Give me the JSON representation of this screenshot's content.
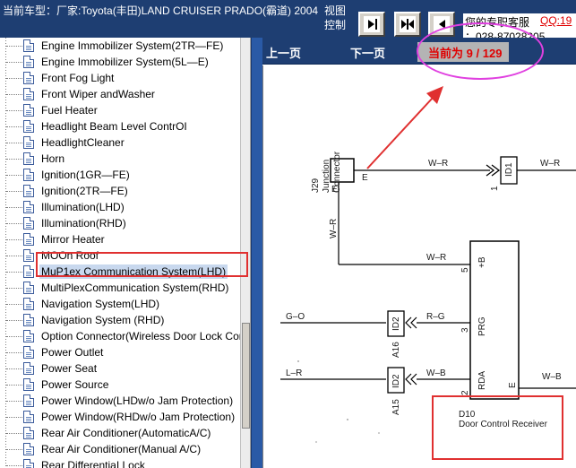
{
  "header": {
    "car_title": "当前车型：厂家:Toyota(丰田)LAND CRUISER PRADO(霸道) 2004",
    "view_label": "视图控制",
    "buttons": [
      {
        "name": "fit-width",
        "icon": "arrow-right-bar-icon"
      },
      {
        "name": "fit-page",
        "icon": "arrows-inward-icon"
      },
      {
        "name": "back",
        "icon": "arrow-left-icon"
      }
    ],
    "service_text": "您的专职客服",
    "service_qq": "QQ:19",
    "service_phone": "：028-87028205"
  },
  "tree": {
    "items": [
      {
        "label": "Engine Immobilizer System(2TR—FE)",
        "selected": false
      },
      {
        "label": "Engine Immobilizer System(5L—E)",
        "selected": false
      },
      {
        "label": "Front Fog Light",
        "selected": false
      },
      {
        "label": "Front Wiper andWasher",
        "selected": false
      },
      {
        "label": "Fuel Heater",
        "selected": false
      },
      {
        "label": "Headlight Beam Level ContrOI",
        "selected": false
      },
      {
        "label": "HeadlightCleaner",
        "selected": false
      },
      {
        "label": "Horn",
        "selected": false
      },
      {
        "label": "Ignition(1GR—FE)",
        "selected": false
      },
      {
        "label": "Ignition(2TR—FE)",
        "selected": false
      },
      {
        "label": "Illumination(LHD)",
        "selected": false
      },
      {
        "label": "Illumination(RHD)",
        "selected": false
      },
      {
        "label": "Mirror Heater",
        "selected": false
      },
      {
        "label": "MOOn Roof",
        "selected": false
      },
      {
        "label": "MuP1ex Communication System(LHD)",
        "selected": true
      },
      {
        "label": "MultiPlexCommunication System(RHD)",
        "selected": false
      },
      {
        "label": "Navigation System(LHD)",
        "selected": false
      },
      {
        "label": "Navigation System (RHD)",
        "selected": false
      },
      {
        "label": "Option Connector(Wireless Door Lock Control)",
        "selected": false
      },
      {
        "label": "Power Outlet",
        "selected": false
      },
      {
        "label": "Power Seat",
        "selected": false
      },
      {
        "label": "Power Source",
        "selected": false
      },
      {
        "label": "Power Window(LHDw/o Jam Protection)",
        "selected": false
      },
      {
        "label": "Power Window(RHDw/o Jam Protection)",
        "selected": false
      },
      {
        "label": "Rear Air Conditioner(AutomaticA/C)",
        "selected": false
      },
      {
        "label": "Rear Air Conditioner(Manual A/C)",
        "selected": false
      },
      {
        "label": "Rear DifferentiaI Lock",
        "selected": false
      }
    ]
  },
  "viewer": {
    "prev_label": "上一页",
    "next_label": "下一页",
    "page_prefix": "当前为",
    "page_current": 9,
    "page_separator": "/",
    "page_total": 129
  },
  "diagram": {
    "junction_label": "J29\nJunction\nConnector",
    "junction_pin": "E",
    "junction_pin2": "E",
    "wire_wr_top": "W–R",
    "wire_wr_top2": "W–R",
    "wire_wr_vertical": "W–R",
    "wire_wr_mid": "W–R",
    "wire_go": "G–O",
    "wire_rg": "R–G",
    "wire_lr": "L–R",
    "wire_wb": "W–B",
    "wire_wb2": "W–B",
    "id1_label": "ID1",
    "id1_pin": "1",
    "id2a_label": "ID2",
    "id2a_ref": "A16",
    "id2b_label": "ID2",
    "id2b_ref": "A15",
    "pin_5": "5",
    "pin_3": "3",
    "pin_2": "2",
    "plus_b": "+B",
    "prg": "PRG",
    "rda": "RDA",
    "e_pin": "E",
    "d10_code": "D10",
    "d10_name": "Door Control Receiver"
  },
  "colors": {
    "header_bg": "#1e3e72",
    "splitter": "#2a5aa6",
    "annotation_magenta": "#e040e0",
    "annotation_red": "#e03030",
    "page_indicator_text": "#e00000"
  }
}
